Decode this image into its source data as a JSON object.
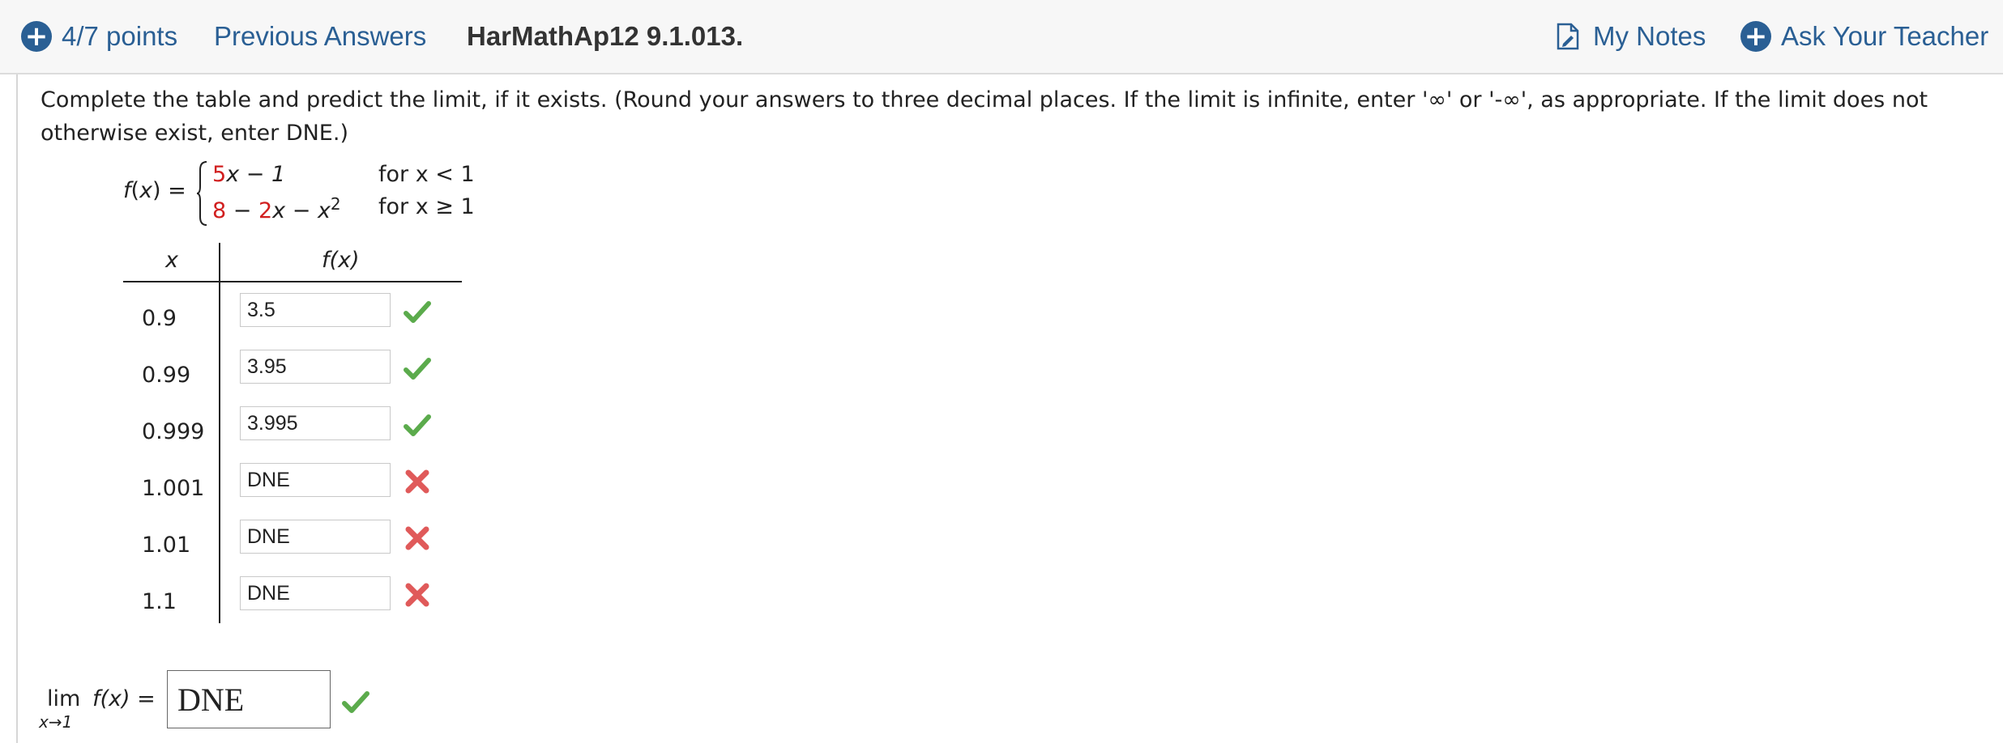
{
  "header": {
    "points": "4/7 points",
    "previous_answers": "Previous Answers",
    "problem_id": "HarMathAp12 9.1.013.",
    "my_notes": "My Notes",
    "ask_teacher": "Ask Your Teacher",
    "accent_color": "#2a5f94"
  },
  "question": {
    "instructions": "Complete the table and predict the limit, if it exists. (Round your answers to three decimal places. If the limit is infinite, enter '∞' or '-∞', as appropriate. If the limit does not otherwise exist, enter DNE.)"
  },
  "function": {
    "lhs": "f(x) =",
    "piece1": {
      "coef": "5",
      "rest": "x − 1",
      "condition": "for x < 1"
    },
    "piece2": {
      "const": "8",
      "mid": " − ",
      "coef": "2",
      "rest": "x − x",
      "exp": "2",
      "condition": "for x ≥ 1"
    }
  },
  "table": {
    "header_x": "x",
    "header_fx": "f(x)",
    "rows": [
      {
        "x": "0.9",
        "value": "3.5",
        "status": "correct"
      },
      {
        "x": "0.99",
        "value": "3.95",
        "status": "correct"
      },
      {
        "x": "0.999",
        "value": "3.995",
        "status": "correct"
      },
      {
        "x": "1.001",
        "value": "DNE",
        "status": "incorrect"
      },
      {
        "x": "1.01",
        "value": "DNE",
        "status": "incorrect"
      },
      {
        "x": "1.1",
        "value": "DNE",
        "status": "incorrect"
      }
    ]
  },
  "limit": {
    "lim": "lim",
    "sub": "x→1",
    "expr": "f(x) =",
    "answer": "DNE",
    "status": "correct"
  },
  "colors": {
    "correct": "#5bab4c",
    "incorrect": "#e05a5a",
    "highlight": "#d11f1f"
  }
}
